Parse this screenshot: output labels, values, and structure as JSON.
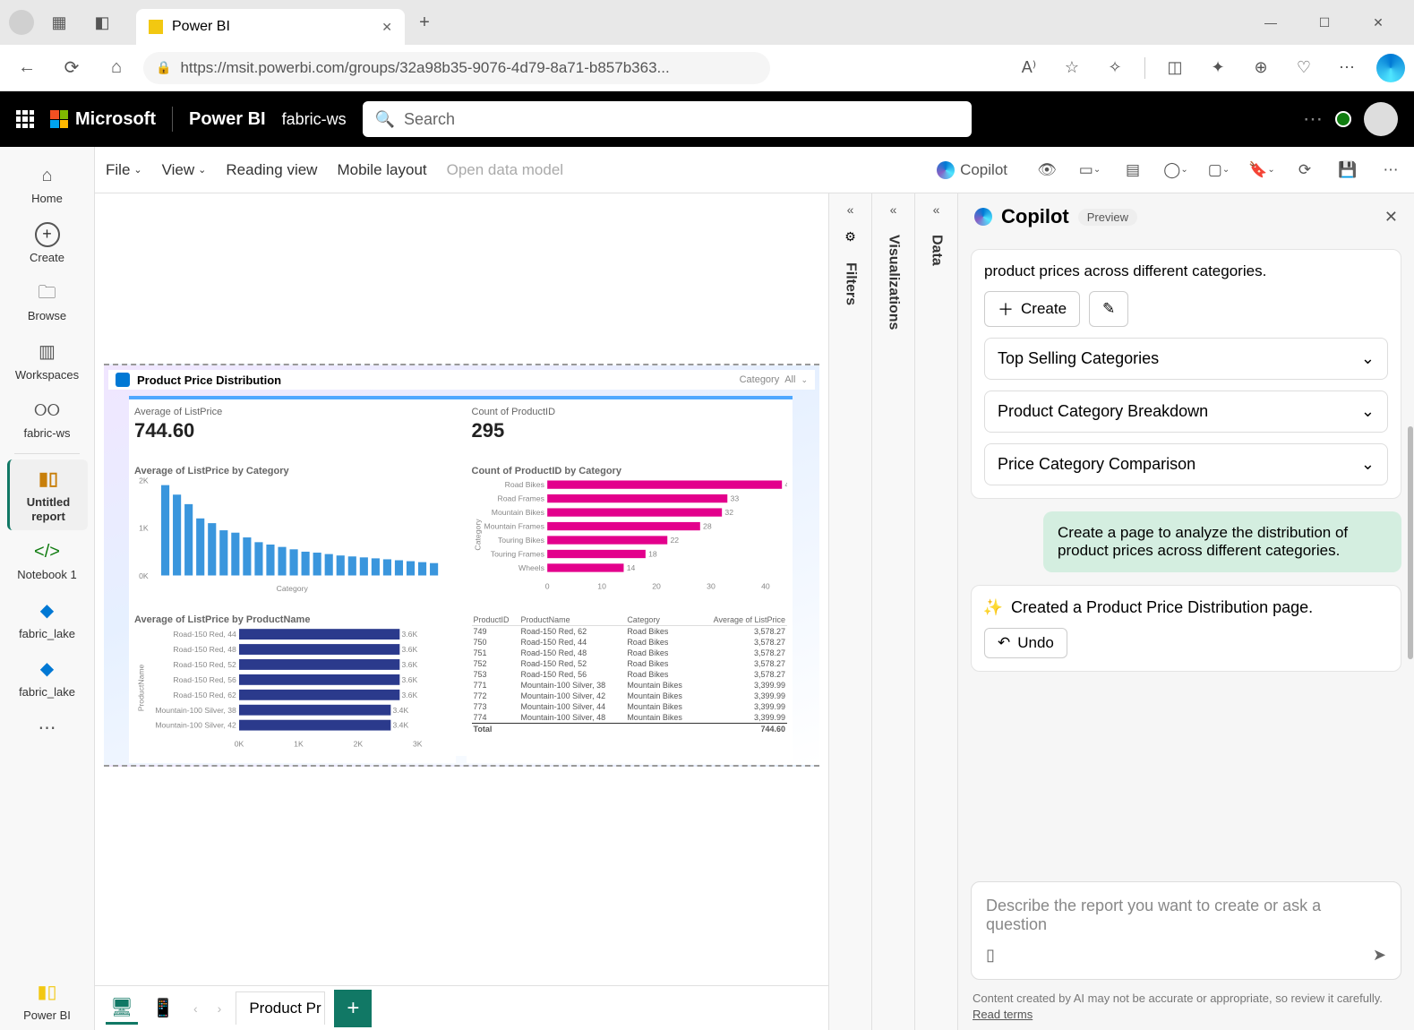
{
  "browser": {
    "tab_title": "Power BI",
    "url": "https://msit.powerbi.com/groups/32a98b35-9076-4d79-8a71-b857b363..."
  },
  "header": {
    "brand1": "Microsoft",
    "brand2": "Power BI",
    "workspace": "fabric-ws",
    "search_placeholder": "Search"
  },
  "rail": {
    "home": "Home",
    "create": "Create",
    "browse": "Browse",
    "workspaces": "Workspaces",
    "ws": "fabric-ws",
    "report": "Untitled report",
    "notebook": "Notebook 1",
    "lake1": "fabric_lake",
    "lake2": "fabric_lake",
    "pbi": "Power BI"
  },
  "toolbar": {
    "file": "File",
    "view": "View",
    "reading": "Reading view",
    "mobile": "Mobile layout",
    "open_dm": "Open data model",
    "copilot": "Copilot"
  },
  "panes": {
    "filters": "Filters",
    "viz": "Visualizations",
    "data": "Data"
  },
  "report": {
    "title": "Product Price Distribution",
    "filter_label": "Category",
    "filter_value": "All",
    "kpi1_title": "Average of ListPrice",
    "kpi1_value": "744.60",
    "kpi2_title": "Count of ProductID",
    "kpi2_value": "295",
    "chart_bl_title": "Average of ListPrice by Category",
    "chart_br_title": "Count of ProductID by Category",
    "chart_bb_title": "Average of ListPrice by ProductName",
    "table_cols": [
      "ProductID",
      "ProductName",
      "Category",
      "Average of ListPrice"
    ]
  },
  "chart_data": {
    "top_left": {
      "type": "bar",
      "title": "Average of ListPrice by Category",
      "xlabel": "Category",
      "ylabel": "",
      "ylim": [
        0,
        2000
      ],
      "yticks": [
        "0K",
        "1K",
        "2K"
      ],
      "values": [
        1900,
        1700,
        1500,
        1200,
        1100,
        950,
        900,
        800,
        700,
        650,
        600,
        550,
        500,
        480,
        450,
        420,
        400,
        380,
        360,
        340,
        320,
        300,
        280,
        260
      ]
    },
    "top_right": {
      "type": "bar",
      "orientation": "horizontal",
      "title": "Count of ProductID by Category",
      "xlabel": "",
      "ylabel": "Category",
      "xlim": [
        0,
        40
      ],
      "xticks": [
        0,
        10,
        20,
        30,
        40
      ],
      "categories": [
        "Road Bikes",
        "Road Frames",
        "Mountain Bikes",
        "Mountain Frames",
        "Touring Bikes",
        "Touring Frames",
        "Wheels"
      ],
      "values": [
        43,
        33,
        32,
        28,
        22,
        18,
        14
      ]
    },
    "bottom_left": {
      "type": "bar",
      "orientation": "horizontal",
      "title": "Average of ListPrice by ProductName",
      "ylabel": "ProductName",
      "xlim": [
        0,
        4000
      ],
      "xticks": [
        "0K",
        "1K",
        "2K",
        "3K"
      ],
      "categories": [
        "Road-150 Red, 44",
        "Road-150 Red, 48",
        "Road-150 Red, 52",
        "Road-150 Red, 56",
        "Road-150 Red, 62",
        "Mountain-100 Silver, 38",
        "Mountain-100 Silver, 42"
      ],
      "values": [
        3600,
        3600,
        3600,
        3600,
        3600,
        3400,
        3400
      ],
      "value_labels": [
        "3.6K",
        "3.6K",
        "3.6K",
        "3.6K",
        "3.6K",
        "3.4K",
        "3.4K"
      ]
    },
    "table": {
      "columns": [
        "ProductID",
        "ProductName",
        "Category",
        "Average of ListPrice"
      ],
      "rows": [
        [
          "749",
          "Road-150 Red, 62",
          "Road Bikes",
          "3,578.27"
        ],
        [
          "750",
          "Road-150 Red, 44",
          "Road Bikes",
          "3,578.27"
        ],
        [
          "751",
          "Road-150 Red, 48",
          "Road Bikes",
          "3,578.27"
        ],
        [
          "752",
          "Road-150 Red, 52",
          "Road Bikes",
          "3,578.27"
        ],
        [
          "753",
          "Road-150 Red, 56",
          "Road Bikes",
          "3,578.27"
        ],
        [
          "771",
          "Mountain-100 Silver, 38",
          "Mountain Bikes",
          "3,399.99"
        ],
        [
          "772",
          "Mountain-100 Silver, 42",
          "Mountain Bikes",
          "3,399.99"
        ],
        [
          "773",
          "Mountain-100 Silver, 44",
          "Mountain Bikes",
          "3,399.99"
        ],
        [
          "774",
          "Mountain-100 Silver, 48",
          "Mountain Bikes",
          "3,399.99"
        ]
      ],
      "total": [
        "Total",
        "",
        "",
        "744.60"
      ]
    }
  },
  "copilot": {
    "title": "Copilot",
    "badge": "Preview",
    "intro_tail": "product prices across different categories.",
    "create_btn": "Create",
    "sug1": "Top Selling Categories",
    "sug2": "Product Category Breakdown",
    "sug3": "Price Category Comparison",
    "user_msg": "Create a page to analyze the distribution of product prices across different categories.",
    "created_msg": "Created a Product Price Distribution page.",
    "undo": "Undo",
    "input_placeholder": "Describe the report you want to create or ask a question",
    "footer": "Content created by AI may not be accurate or appropriate, so review it carefully.",
    "read_terms": "Read terms"
  },
  "page_tabs": {
    "tab1": "Product Pr"
  }
}
